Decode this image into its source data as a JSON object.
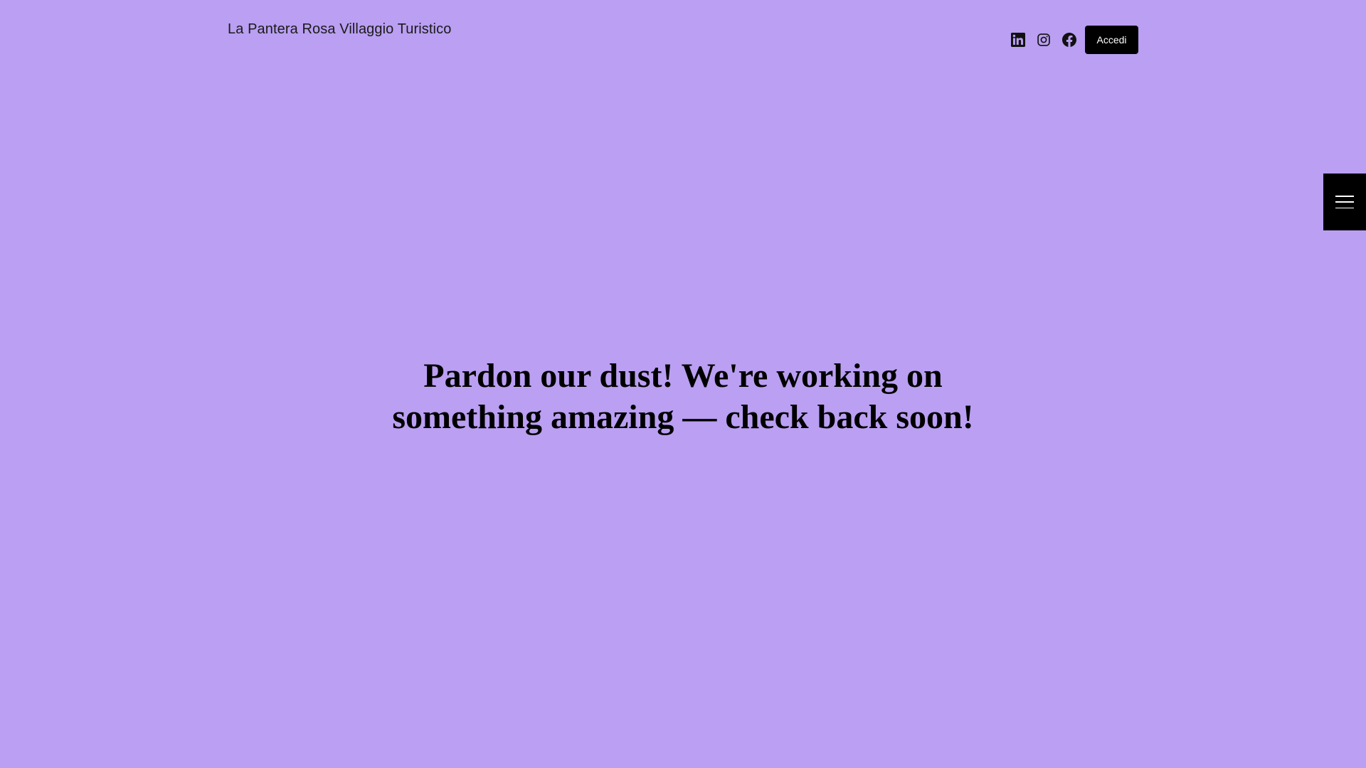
{
  "header": {
    "site_title": "La Pantera Rosa Villaggio Turistico",
    "social": [
      {
        "name": "linkedin-icon",
        "label": "LinkedIn"
      },
      {
        "name": "instagram-icon",
        "label": "Instagram"
      },
      {
        "name": "facebook-icon",
        "label": "Facebook"
      }
    ],
    "login_label": "Accedi"
  },
  "side_menu": {
    "icon": "hamburger-menu-icon"
  },
  "main": {
    "message_line1": "Pardon our dust! We're working on",
    "message_line2": "something amazing — check back soon!"
  },
  "colors": {
    "background": "#ba9ff2",
    "button": "#000000",
    "button_text": "#ffffff",
    "text": "#000000"
  }
}
